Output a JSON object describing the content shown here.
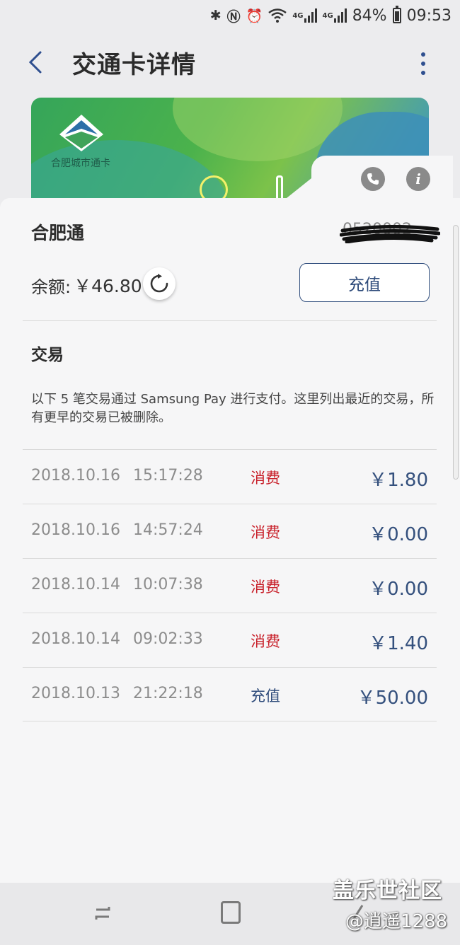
{
  "status_bar": {
    "battery": "84%",
    "time": "09:53",
    "signal1": "4G",
    "signal2": "4G",
    "icons": [
      "bluetooth-icon",
      "nfc-icon",
      "alarm-icon",
      "wifi-icon",
      "signal-icon",
      "signal-icon",
      "battery-icon"
    ]
  },
  "header": {
    "title": "交通卡详情"
  },
  "card": {
    "brand_label": "合肥城市通卡",
    "name": "合肥通",
    "number": "0520002"
  },
  "balance": {
    "label": "余额:",
    "value": "￥46.80"
  },
  "topup_button": "充值",
  "transactions": {
    "title": "交易",
    "notice": "以下 5 笔交易通过 Samsung Pay 进行支付。这里列出最近的交易，所有更早的交易已被删除。",
    "rows": [
      {
        "date": "2018.10.16",
        "time": "15:17:28",
        "type": "消费",
        "amount": "￥1.80"
      },
      {
        "date": "2018.10.16",
        "time": "14:57:24",
        "type": "消费",
        "amount": "￥0.00"
      },
      {
        "date": "2018.10.14",
        "time": "10:07:38",
        "type": "消费",
        "amount": "￥0.00"
      },
      {
        "date": "2018.10.14",
        "time": "09:02:33",
        "type": "消费",
        "amount": "￥1.40"
      },
      {
        "date": "2018.10.13",
        "time": "21:22:18",
        "type": "充值",
        "amount": "￥50.00"
      }
    ]
  },
  "watermark": {
    "line1": "盖乐世社区",
    "line2": "@逍遥1288"
  },
  "colors": {
    "accent": "#2d4a7a",
    "spend": "#c8202a",
    "topup": "#2d4a7a"
  }
}
